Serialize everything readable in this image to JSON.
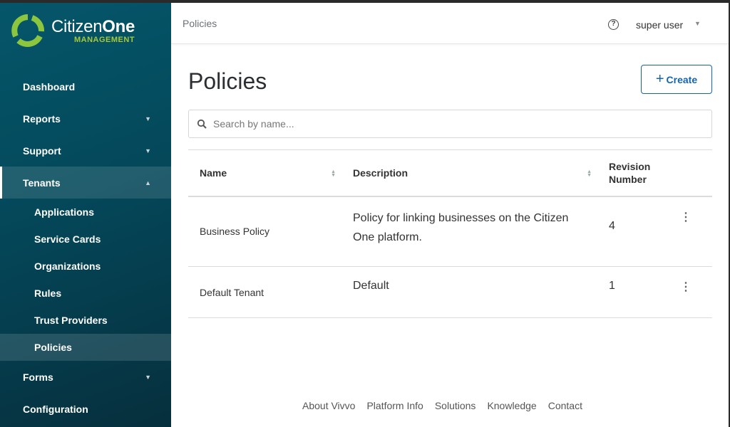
{
  "brand": {
    "name_light": "Citizen",
    "name_bold": "One",
    "sub": "MANAGEMENT"
  },
  "sidebar": {
    "items": [
      {
        "label": "Dashboard"
      },
      {
        "label": "Reports"
      },
      {
        "label": "Support"
      },
      {
        "label": "Tenants"
      },
      {
        "label": "Forms"
      },
      {
        "label": "Configuration"
      }
    ],
    "tenants_sub": [
      {
        "label": "Applications"
      },
      {
        "label": "Service Cards"
      },
      {
        "label": "Organizations"
      },
      {
        "label": "Rules"
      },
      {
        "label": "Trust Providers"
      },
      {
        "label": "Policies"
      }
    ]
  },
  "header": {
    "breadcrumb": "Policies",
    "help": "?",
    "user": "super user"
  },
  "page": {
    "title": "Policies",
    "create_label": "Create",
    "search_placeholder": "Search by name..."
  },
  "table": {
    "headers": {
      "name": "Name",
      "description": "Description",
      "revision": "Revision Number"
    },
    "rows": [
      {
        "name": "Business Policy",
        "description": "Policy for linking businesses on the Citizen One platform.",
        "revision": "4"
      },
      {
        "name": "Default Tenant",
        "description": "Default",
        "revision": "1"
      }
    ]
  },
  "footer": [
    "About Vivvo",
    "Platform Info",
    "Solutions",
    "Knowledge",
    "Contact"
  ]
}
